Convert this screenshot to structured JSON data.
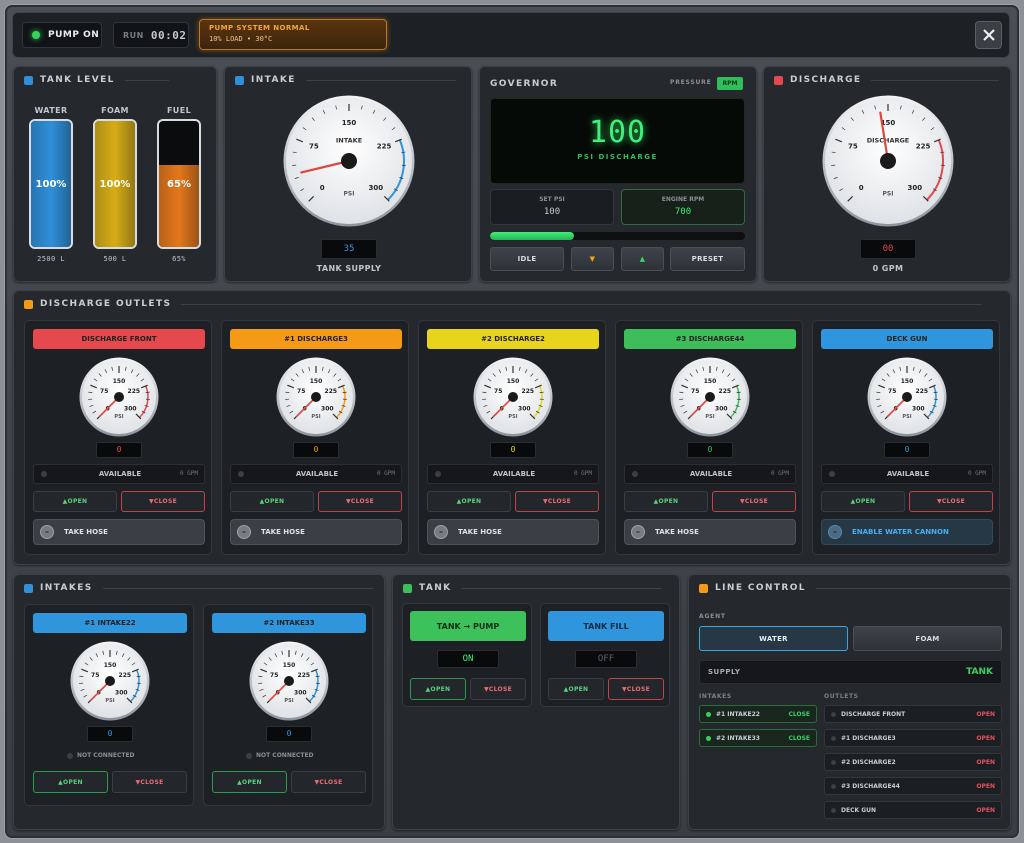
{
  "topbar": {
    "pump_label": "PUMP ON",
    "run_label": "RUN",
    "run_time": "00:02",
    "status_title": "PUMP SYSTEM NORMAL",
    "status_detail": "10% LOAD • 30°C"
  },
  "tank_level": {
    "title": "TANK LEVEL",
    "tanks": [
      {
        "name": "WATER",
        "percent": 100,
        "percent_text": "100%",
        "amount": "2500 L",
        "color": "#2f8fd9"
      },
      {
        "name": "FOAM",
        "percent": 100,
        "percent_text": "100%",
        "amount": "500 L",
        "color": "#d6ad17"
      },
      {
        "name": "FUEL",
        "percent": 65,
        "percent_text": "65%",
        "amount": "65%",
        "color": "#e3771b"
      }
    ]
  },
  "intake": {
    "title": "INTAKE",
    "gauge_label": "INTAKE",
    "unit": "PSI",
    "value": 35,
    "readout": "35",
    "caption": "TANK SUPPLY"
  },
  "governor": {
    "title": "GOVERNOR",
    "mode_pressure": "PRESSURE",
    "mode_rpm": "RPM",
    "display_value": "100",
    "display_label": "PSI DISCHARGE",
    "set_psi_label": "SET PSI",
    "set_psi_value": "100",
    "engine_rpm_label": "ENGINE RPM",
    "engine_rpm_value": "700",
    "progress": 0.33,
    "idle": "IDLE",
    "down": "▼",
    "up": "▲",
    "preset": "PRESET"
  },
  "discharge": {
    "title": "DISCHARGE",
    "gauge_label": "DISCHARGE",
    "unit": "PSI",
    "value": 140,
    "readout": "00",
    "caption": "0 GPM"
  },
  "gauge_ticks": [
    "0",
    "75",
    "150",
    "225",
    "300"
  ],
  "discharge_outlets": {
    "title": "DISCHARGE OUTLETS",
    "outlets": [
      {
        "name": "DISCHARGE FRONT",
        "color": "#e5484d",
        "readout": "0",
        "readout_color": "#e5484d",
        "unit": "PSI",
        "available": "AVAILABLE",
        "gpm": "0 GPM",
        "open": "▲OPEN",
        "close": "▼CLOSE",
        "action": "TAKE HOSE",
        "value": 0
      },
      {
        "name": "#1 DISCHARGE3",
        "color": "#f49a16",
        "readout": "0",
        "readout_color": "#f49a16",
        "unit": "PSI",
        "available": "AVAILABLE",
        "gpm": "0 GPM",
        "open": "▲OPEN",
        "close": "▼CLOSE",
        "action": "TAKE HOSE",
        "value": 0
      },
      {
        "name": "#2 DISCHARGE2",
        "color": "#e8d41d",
        "readout": "0",
        "readout_color": "#e8d41d",
        "unit": "PSI",
        "available": "AVAILABLE",
        "gpm": "0 GPM",
        "open": "▲OPEN",
        "close": "▼CLOSE",
        "action": "TAKE HOSE",
        "value": 0
      },
      {
        "name": "#3 DISCHARGE44",
        "color": "#3dbe5b",
        "readout": "0",
        "readout_color": "#3dbe5b",
        "unit": "PSI",
        "available": "AVAILABLE",
        "gpm": "0 GPM",
        "open": "▲OPEN",
        "close": "▼CLOSE",
        "action": "TAKE HOSE",
        "value": 0
      },
      {
        "name": "DECK GUN",
        "color": "#2f95dd",
        "readout": "0",
        "readout_color": "#2f95dd",
        "unit": "PSI",
        "available": "AVAILABLE",
        "gpm": "0 GPM",
        "open": "▲OPEN",
        "close": "▼CLOSE",
        "action": "ENABLE WATER CANNON",
        "value": 0
      }
    ]
  },
  "intakes": {
    "title": "INTAKES",
    "items": [
      {
        "name": "#1 INTAKE22",
        "color": "#2f95dd",
        "readout": "0",
        "unit": "PSI",
        "status": "NOT CONNECTED",
        "open": "▲OPEN",
        "close": "▼CLOSE",
        "value": 0
      },
      {
        "name": "#2 INTAKE33",
        "color": "#2f95dd",
        "readout": "0",
        "unit": "PSI",
        "status": "NOT CONNECTED",
        "open": "▲OPEN",
        "close": "▼CLOSE",
        "value": 0
      }
    ]
  },
  "tank": {
    "title": "TANK",
    "to_pump": {
      "label": "TANK → PUMP",
      "state": "ON",
      "open": "▲OPEN",
      "close": "▼CLOSE"
    },
    "fill": {
      "label": "TANK FILL",
      "state": "OFF",
      "open": "▲OPEN",
      "close": "▼CLOSE"
    }
  },
  "line_control": {
    "title": "LINE CONTROL",
    "agent_label": "AGENT",
    "water": "WATER",
    "foam": "FOAM",
    "supply_label": "SUPPLY",
    "supply_value": "TANK",
    "intakes_label": "INTAKES",
    "outlets_label": "OUTLETS",
    "intakes": [
      {
        "name": "#1 INTAKE22",
        "state": "CLOSE"
      },
      {
        "name": "#2 INTAKE33",
        "state": "CLOSE"
      }
    ],
    "outlets": [
      {
        "name": "DISCHARGE FRONT",
        "state": "OPEN"
      },
      {
        "name": "#1 DISCHARGE3",
        "state": "OPEN"
      },
      {
        "name": "#2 DISCHARGE2",
        "state": "OPEN"
      },
      {
        "name": "#3 DISCHARGE44",
        "state": "OPEN"
      },
      {
        "name": "DECK GUN",
        "state": "OPEN"
      }
    ]
  },
  "close_icon": "close-icon"
}
